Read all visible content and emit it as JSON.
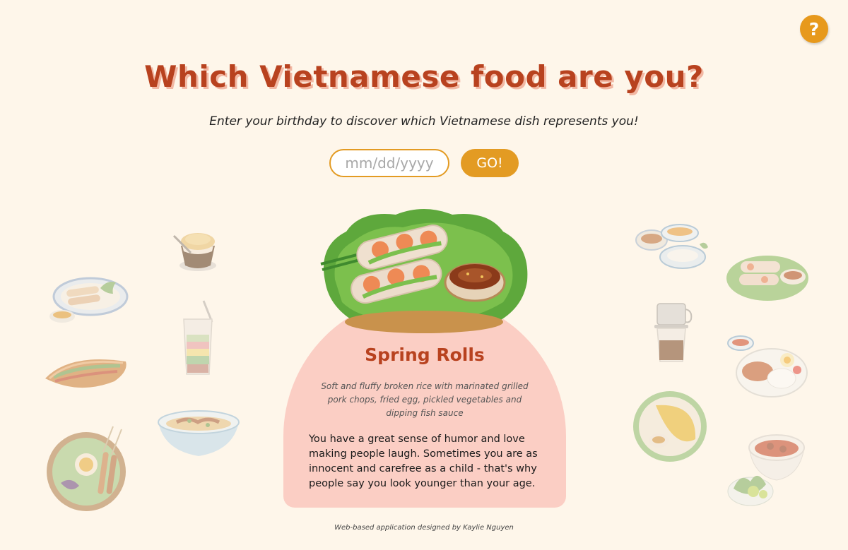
{
  "help": {
    "label": "?"
  },
  "header": {
    "title": "Which Vietnamese food are you?",
    "subtitle": "Enter your birthday to discover which Vietnamese dish represents you!"
  },
  "form": {
    "date_placeholder": "mm/dd/yyyy",
    "date_value": "",
    "go_label": "GO!"
  },
  "result": {
    "dish_name": "Spring Rolls",
    "description": "Soft and fluffy broken rice with marinated grilled pork chops, fried egg, pickled vegetables and dipping fish sauce",
    "personality": "You have a great sense of humor and love making people laugh. Sometimes you are as innocent and carefree as a child - that's why people say you look younger than your age."
  },
  "footer": {
    "credit": "Web-based application designed by Kaylie Nguyen"
  },
  "colors": {
    "background": "#fef6ea",
    "accent": "#e39b23",
    "title": "#b8421f",
    "card": "#fbcec4"
  }
}
